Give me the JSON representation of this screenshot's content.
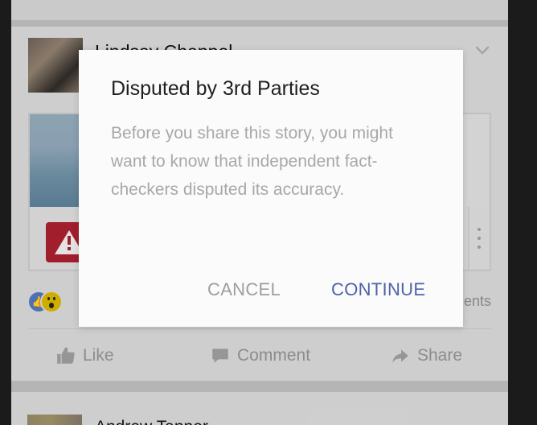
{
  "feed": {
    "post": {
      "author_name": "Lindsay Chappel",
      "comments_label": "ments"
    },
    "actions": {
      "like": "Like",
      "comment": "Comment",
      "share": "Share"
    },
    "next_post": {
      "author_name": "Andrew Tanner"
    }
  },
  "dialog": {
    "title": "Disputed by 3rd Parties",
    "message": "Before you share this story, you might want to know that independent fact-checkers disputed its accuracy.",
    "cancel_label": "CANCEL",
    "continue_label": "CONTINUE"
  },
  "colors": {
    "dialog_accent": "#4f62a9",
    "warning_red": "#a51f2d",
    "like_blue": "#4f74b8"
  },
  "icons": [
    "chevron-down-icon",
    "warning-icon",
    "more-vertical-icon",
    "like-reaction-icon",
    "wow-reaction-icon",
    "thumbs-up-icon",
    "comment-icon",
    "share-icon"
  ]
}
